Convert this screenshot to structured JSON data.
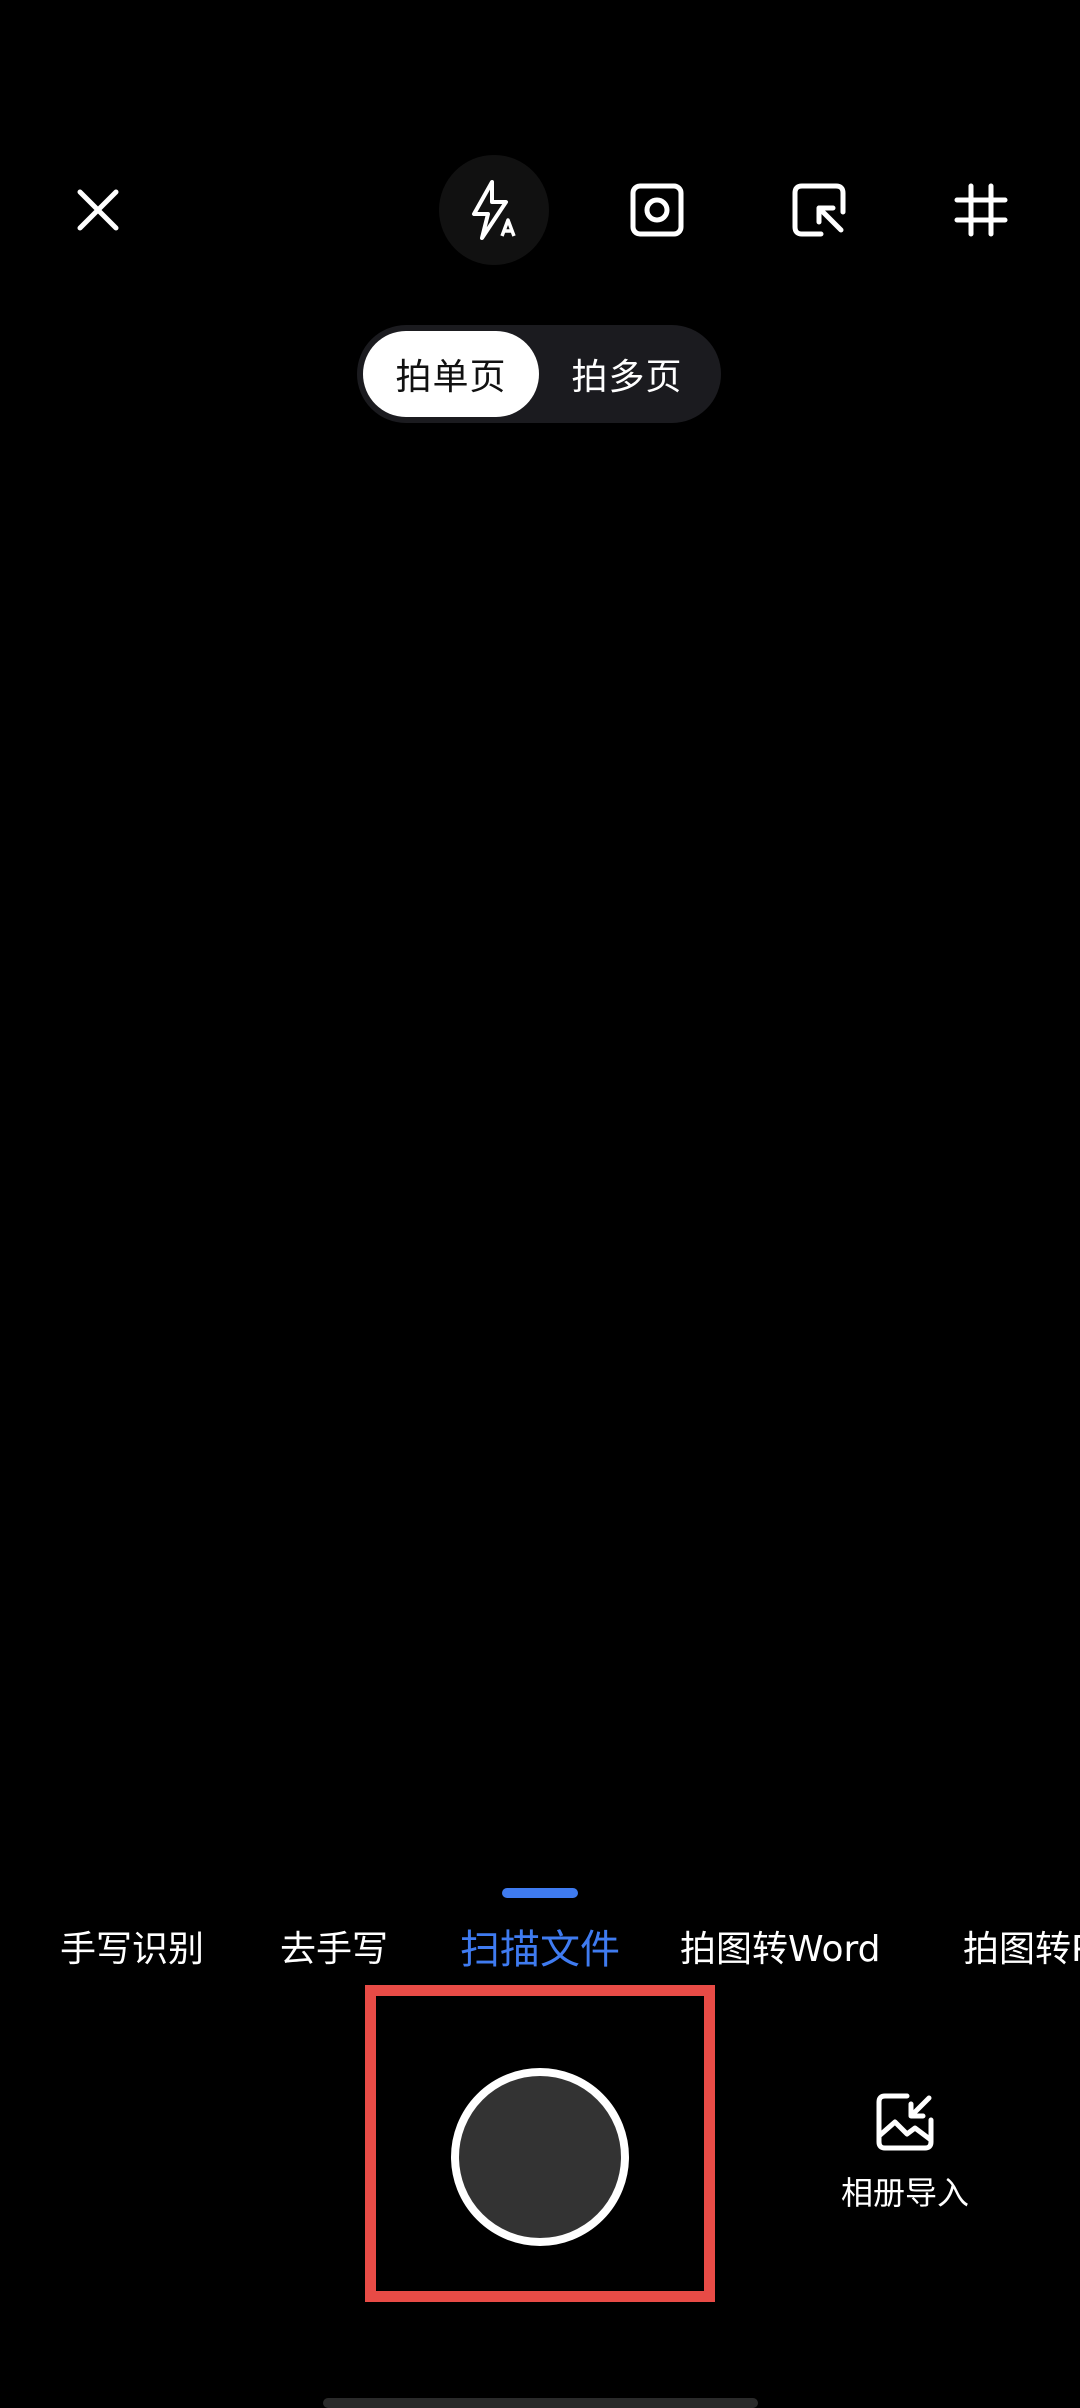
{
  "toolbar": {
    "close_icon": "close-icon",
    "flash_icon": "flash-auto-icon",
    "photo_icon": "photo-frame-icon",
    "capture_icon": "screen-capture-icon",
    "grid_icon": "crop-grid-icon"
  },
  "page_toggle": {
    "single": "拍单页",
    "multi": "拍多页",
    "selected": "拍单页"
  },
  "modes": {
    "items": [
      "手写识别",
      "去手写",
      "扫描文件",
      "拍图转Word",
      "拍图转P"
    ],
    "active": "扫描文件"
  },
  "shutter": {
    "icon": "shutter-button-icon"
  },
  "album": {
    "label": "相册导入",
    "icon": "album-import-icon"
  },
  "colors": {
    "accent": "#3f7bf0",
    "highlight": "#e84b46",
    "background": "#000000"
  }
}
